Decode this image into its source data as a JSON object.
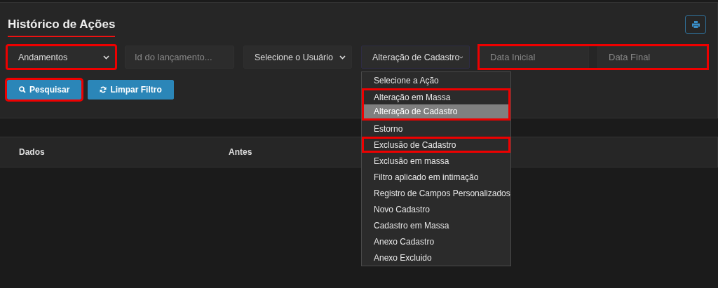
{
  "title": "Histórico de Ações",
  "filters": [
    {
      "kind": "select",
      "value": "Andamentos",
      "highlighted": true
    },
    {
      "kind": "input",
      "placeholder": "Id do lançamento...",
      "highlighted": false
    },
    {
      "kind": "select",
      "value": "Selecione o Usuário",
      "highlighted": false
    },
    {
      "kind": "select",
      "value": "Alteração de Cadastro",
      "highlighted": false,
      "expanded": true
    }
  ],
  "date_range": {
    "highlighted": true,
    "fields": [
      {
        "placeholder": "Data Inicial"
      },
      {
        "placeholder": "Data Final"
      }
    ]
  },
  "buttons": [
    {
      "kind": "search",
      "label": "Pesquisar",
      "highlighted": true
    },
    {
      "kind": "refresh",
      "label": "Limpar Filtro",
      "highlighted": false
    }
  ],
  "menu": [
    {
      "label": "Selecione a Ação",
      "selected": false,
      "highlighted": false
    },
    {
      "label": "Alteração em Massa",
      "selected": false,
      "highlighted": true
    },
    {
      "label": "Alteração de Cadastro",
      "selected": true,
      "highlighted": true
    },
    {
      "label": "Estorno",
      "selected": false,
      "highlighted": false
    },
    {
      "label": "Exclusão de Cadastro",
      "selected": false,
      "highlighted": true
    },
    {
      "label": "Exclusão em massa",
      "selected": false,
      "highlighted": false
    },
    {
      "label": "Filtro aplicado em intimação",
      "selected": false,
      "highlighted": false
    },
    {
      "label": "Registro de Campos Personalizados",
      "selected": false,
      "highlighted": false
    },
    {
      "label": "Novo Cadastro",
      "selected": false,
      "highlighted": false
    },
    {
      "label": "Cadastro em Massa",
      "selected": false,
      "highlighted": false
    },
    {
      "label": "Anexo Cadastro",
      "selected": false,
      "highlighted": false
    },
    {
      "label": "Anexo Excluido",
      "selected": false,
      "highlighted": false
    }
  ],
  "table": {
    "columns": [
      "Dados",
      "Antes"
    ]
  }
}
